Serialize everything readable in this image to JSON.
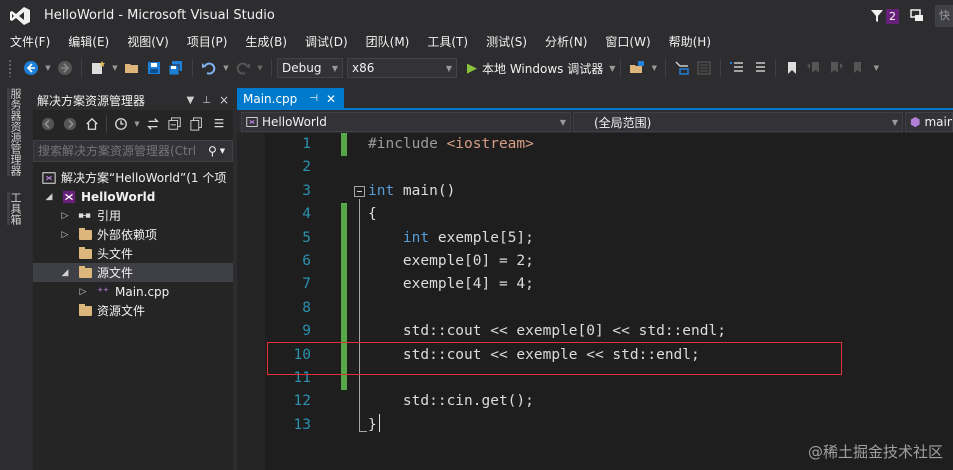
{
  "window": {
    "title": "HelloWorld - Microsoft Visual Studio",
    "notification_count": "2",
    "quick_launch": "快"
  },
  "menu": [
    "文件(F)",
    "编辑(E)",
    "视图(V)",
    "项目(P)",
    "生成(B)",
    "调试(D)",
    "团队(M)",
    "工具(T)",
    "测试(S)",
    "分析(N)",
    "窗口(W)",
    "帮助(H)"
  ],
  "toolbar": {
    "configuration": "Debug",
    "platform": "x86",
    "run_label": "本地 Windows 调试器"
  },
  "side_tabs": [
    "服务器资源管理器",
    "工具箱"
  ],
  "solution_explorer": {
    "title": "解决方案资源管理器",
    "search_placeholder": "搜索解决方案资源管理器(Ctrl",
    "tree": [
      {
        "label": "解决方案“HelloWorld”(1 个项",
        "icon": "solution-icon"
      },
      {
        "label": "HelloWorld",
        "icon": "project-icon"
      },
      {
        "label": "引用",
        "icon": "references-icon"
      },
      {
        "label": "外部依赖项",
        "icon": "folder-icon"
      },
      {
        "label": "头文件",
        "icon": "folder-icon"
      },
      {
        "label": "源文件",
        "icon": "folder-open-icon",
        "selected": true
      },
      {
        "label": "Main.cpp",
        "icon": "cpp-file-icon"
      },
      {
        "label": "资源文件",
        "icon": "folder-icon"
      }
    ]
  },
  "editor": {
    "tab_label": "Main.cpp",
    "nav_project": "HelloWorld",
    "nav_scope": "(全局范围)",
    "nav_member": "main",
    "line_numbers": [
      "1",
      "2",
      "3",
      "4",
      "5",
      "6",
      "7",
      "8",
      "9",
      "10",
      "11",
      "12",
      "13"
    ],
    "code": [
      {
        "pre": "#include ",
        "str": "<iostream>"
      },
      {},
      {
        "kw": "int",
        "rest": " main()"
      },
      {
        "rest": "{"
      },
      {
        "indent": "    ",
        "kw": "int",
        "rest": " exemple[5];"
      },
      {
        "indent": "    ",
        "rest": "exemple[0] = 2;"
      },
      {
        "indent": "    ",
        "rest": "exemple[4] = 4;"
      },
      {},
      {
        "indent": "    ",
        "rest": "std::cout << exemple[0] << std::endl;"
      },
      {
        "indent": "    ",
        "rest": "std::cout << exemple << std::endl;"
      },
      {},
      {
        "indent": "    ",
        "rest": "std::cin.get();"
      },
      {
        "rest": "}"
      }
    ]
  },
  "watermark": "@稀土掘金技术社区",
  "colors": {
    "accent": "#007acc",
    "keyword": "#569cd6",
    "string": "#d69d85",
    "line_number": "#2b91af",
    "change_bar": "#57a64a",
    "highlight_box": "#e0303b"
  }
}
